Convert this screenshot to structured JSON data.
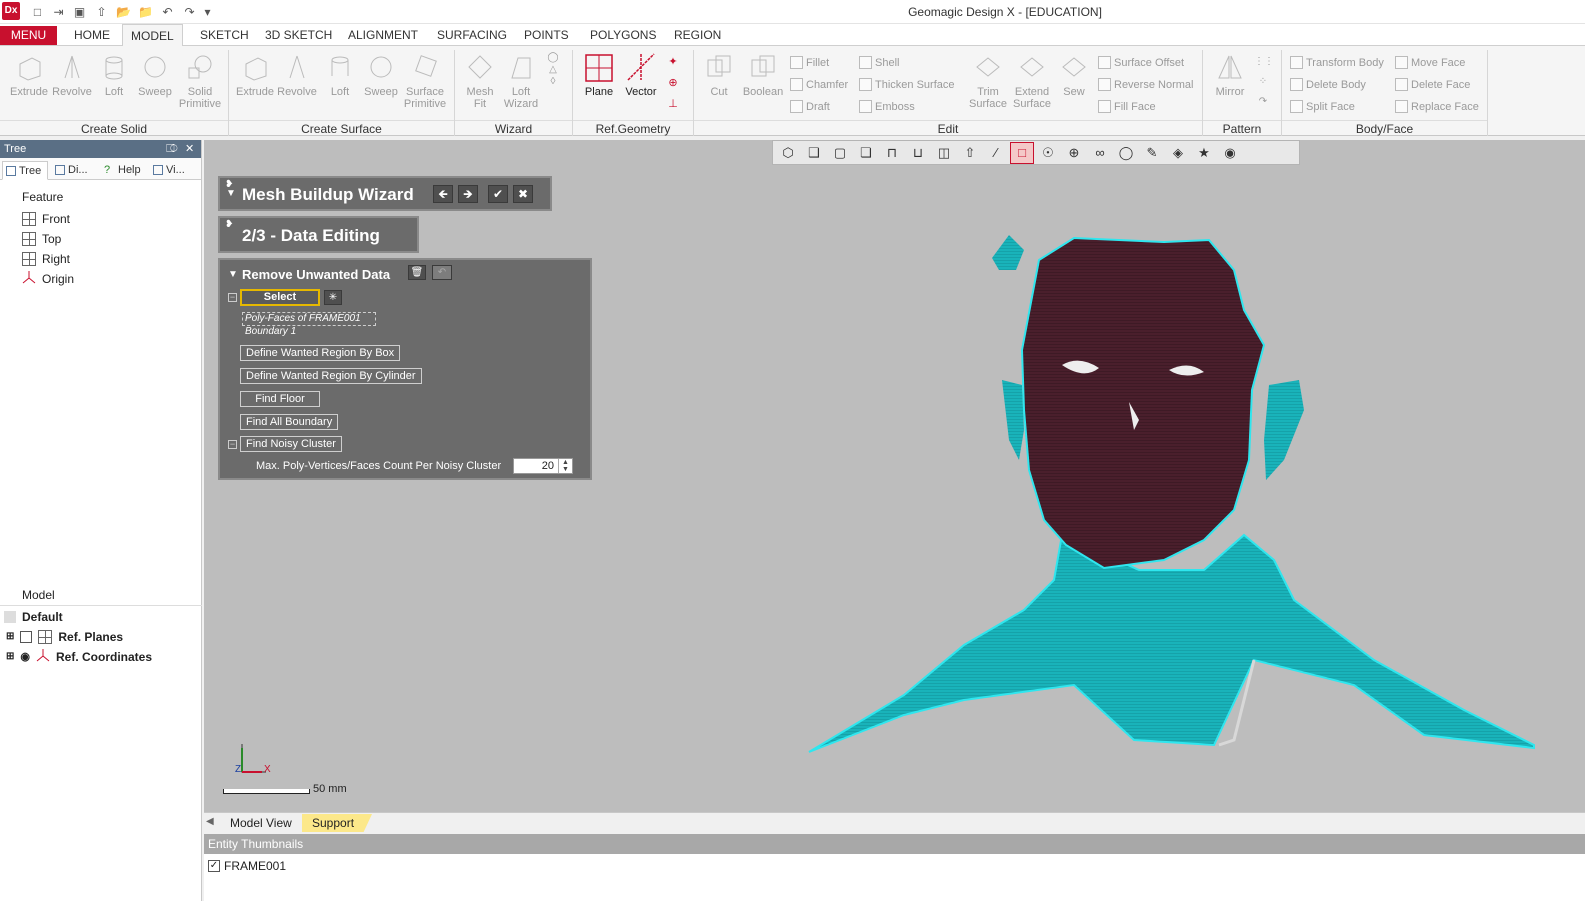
{
  "app": {
    "logo": "Dx",
    "title": "Geomagic Design X - [EDUCATION]"
  },
  "menu": {
    "menu_label": "MENU",
    "tabs": [
      "HOME",
      "MODEL",
      "SKETCH",
      "3D SKETCH",
      "ALIGNMENT",
      "SURFACING",
      "POINTS",
      "POLYGONS",
      "REGION"
    ],
    "active_tab": "MODEL"
  },
  "ribbon": {
    "create_solid": {
      "label": "Create Solid",
      "items": [
        "Extrude",
        "Revolve",
        "Loft",
        "Sweep",
        "Solid Primitive"
      ]
    },
    "create_surface": {
      "label": "Create Surface",
      "items": [
        "Extrude",
        "Revolve",
        "Loft",
        "Sweep",
        "Surface Primitive"
      ]
    },
    "wizard": {
      "label": "Wizard",
      "items": [
        "Mesh Fit",
        "Loft Wizard"
      ]
    },
    "ref_geometry": {
      "label": "Ref.Geometry",
      "items": [
        "Plane",
        "Vector"
      ]
    },
    "edit": {
      "label": "Edit",
      "items": [
        "Cut",
        "Boolean",
        "Fillet",
        "Chamfer",
        "Draft",
        "Shell",
        "Thicken Surface",
        "Emboss",
        "Trim Surface",
        "Extend Surface",
        "Sew",
        "Surface Offset",
        "Reverse Normal",
        "Fill Face"
      ]
    },
    "pattern": {
      "label": "Pattern",
      "items": [
        "Mirror"
      ]
    },
    "body_face": {
      "label": "Body/Face",
      "items": [
        "Transform Body",
        "Delete Body",
        "Split Face",
        "Move Face",
        "Delete Face",
        "Replace Face"
      ]
    }
  },
  "left_panel": {
    "header": "Tree",
    "tabs": [
      "Tree",
      "Di...",
      "Help",
      "Vi..."
    ],
    "feature_title": "Feature",
    "features": [
      "Front",
      "Top",
      "Right",
      "Origin"
    ],
    "model_title": "Model",
    "model_items": [
      "Default",
      "Ref. Planes",
      "Ref. Coordinates"
    ]
  },
  "wizard": {
    "title": "Mesh Buildup Wizard",
    "step": "2/3 - Data Editing",
    "section_title": "Remove Unwanted Data",
    "select_label": "Select",
    "selection_items": [
      "Poly-Faces of FRAME001",
      "Boundary 1"
    ],
    "buttons": [
      "Define Wanted Region By Box",
      "Define Wanted Region By Cylinder",
      "Find Floor",
      "Find All Boundary",
      "Find Noisy Cluster"
    ],
    "noisy_label": "Max. Poly-Vertices/Faces Count Per Noisy Cluster",
    "noisy_value": "20"
  },
  "viewport": {
    "scale_label": "50 mm",
    "axis_x": "X",
    "axis_z": "Z",
    "scan_colors": {
      "face": "#4a1f2c",
      "body": "#19b3ba",
      "outline": "#2fe6ee"
    }
  },
  "bottom_tabs": [
    "Model View",
    "Support"
  ],
  "entity_thumbnails": {
    "header": "Entity Thumbnails",
    "items": [
      "FRAME001"
    ]
  }
}
